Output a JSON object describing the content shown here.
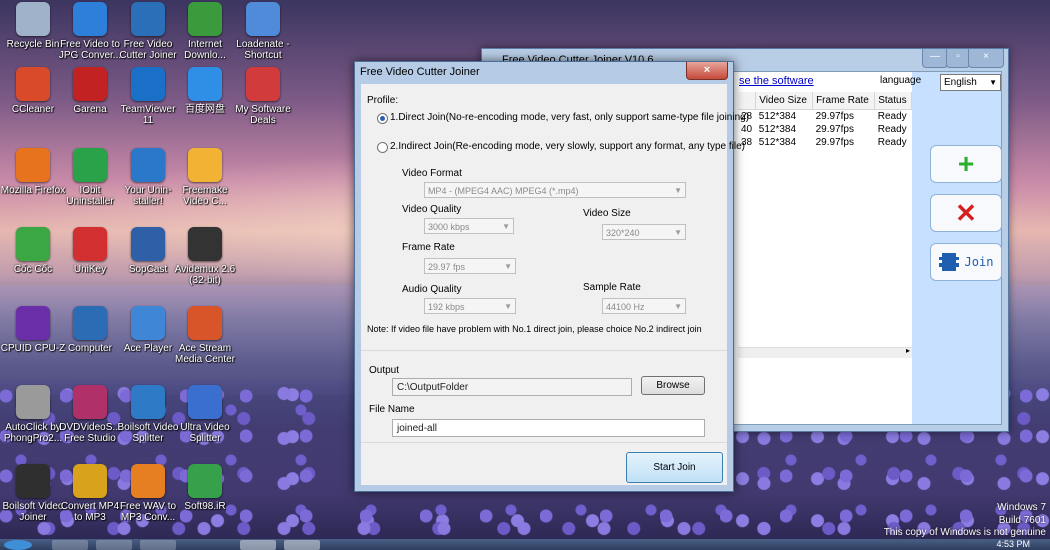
{
  "desktop_icons": [
    {
      "label": "Recycle Bin",
      "color": "#9fb2c9"
    },
    {
      "label": "Free Video to JPG Conver...",
      "color": "#2e7fd9"
    },
    {
      "label": "Free Video Cutter Joiner",
      "color": "#2b6fb8"
    },
    {
      "label": "Internet Downlo...",
      "color": "#3b9a3b"
    },
    {
      "label": "Loadenate - Shortcut",
      "color": "#4f8bd9"
    },
    {
      "label": "CCleaner",
      "color": "#d94a2b"
    },
    {
      "label": "Garena",
      "color": "#c22222"
    },
    {
      "label": "TeamViewer 11",
      "color": "#1a6fc7"
    },
    {
      "label": "百度网盘",
      "color": "#2f8ee5"
    },
    {
      "label": "My Software Deals",
      "color": "#d23b3b"
    },
    {
      "label": "Mozilla Firefox",
      "color": "#e8731e"
    },
    {
      "label": "IObit Uninstaller",
      "color": "#2aa24a"
    },
    {
      "label": "Your Unin-staller!",
      "color": "#2b77c9"
    },
    {
      "label": "Freemake Video C...",
      "color": "#f2b233"
    },
    {
      "label": "Cốc Cốc",
      "color": "#3aa742"
    },
    {
      "label": "UniKey",
      "color": "#d23030"
    },
    {
      "label": "SopCast",
      "color": "#2f5fa7"
    },
    {
      "label": "Avidemux 2.6 (32-bit)",
      "color": "#333333"
    },
    {
      "label": "CPUID CPU-Z",
      "color": "#6a2fa8"
    },
    {
      "label": "Computer",
      "color": "#2c6cb5"
    },
    {
      "label": "Ace Player",
      "color": "#3f87d6"
    },
    {
      "label": "Ace Stream Media Center",
      "color": "#d8552a"
    },
    {
      "label": "AutoClick by PhongPro2...",
      "color": "#9a9a9a"
    },
    {
      "label": "DVDVideoS... Free Studio",
      "color": "#b0306a"
    },
    {
      "label": "Boilsoft Video Splitter",
      "color": "#2e7ac7"
    },
    {
      "label": "Ultra Video Splitter",
      "color": "#3a6fd0"
    },
    {
      "label": "Boilsoft Video Joiner",
      "color": "#2f2f2f"
    },
    {
      "label": "Convert MP4 to MP3",
      "color": "#d9a21d"
    },
    {
      "label": "Free WAV to MP3 Conv...",
      "color": "#e67e22"
    },
    {
      "label": "Soft98.iR",
      "color": "#37a04a"
    }
  ],
  "back_window": {
    "title": "Free Video Cutter Joiner V10.6",
    "link_text": "se the software",
    "language_label": "language",
    "language_value": "English",
    "columns": [
      "",
      "Video Size",
      "Frame Rate",
      "Status"
    ],
    "rows": [
      [
        "28",
        "512*384",
        "29.97fps",
        "Ready"
      ],
      [
        "40",
        "512*384",
        "29.97fps",
        "Ready"
      ],
      [
        "38",
        "512*384",
        "29.97fps",
        "Ready"
      ]
    ],
    "join_label": "Join"
  },
  "dialog": {
    "title": "Free Video Cutter Joiner",
    "profile_label": "Profile:",
    "option1": "1.Direct Join(No-re-encoding mode, very fast, only support same-type file joining)",
    "option2": "2.Indirect Join(Re-encoding mode, very slowly, support any format, any type file)",
    "video_format_label": "Video Format",
    "video_format_value": "MP4 - (MPEG4 AAC) MPEG4 (*.mp4)",
    "video_quality_label": "Video Quality",
    "video_quality_value": "3000 kbps",
    "video_size_label": "Video Size",
    "video_size_value": "320*240",
    "frame_rate_label": "Frame Rate",
    "frame_rate_value": "29.97 fps",
    "audio_quality_label": "Audio Quality",
    "audio_quality_value": "192 kbps",
    "sample_rate_label": "Sample Rate",
    "sample_rate_value": "44100 Hz",
    "note": "Note: If video file have problem with No.1 direct join, please choice No.2 indirect join",
    "output_label": "Output",
    "output_value": "C:\\OutputFolder",
    "browse_label": "Browse",
    "file_name_label": "File Name",
    "file_name_value": "joined-all",
    "start_join_label": "Start Join"
  },
  "watermark": {
    "line1": "Windows 7",
    "line2": "Build 7601",
    "line3": "This copy of Windows is not genuine",
    "clock": "4:53 PM"
  }
}
